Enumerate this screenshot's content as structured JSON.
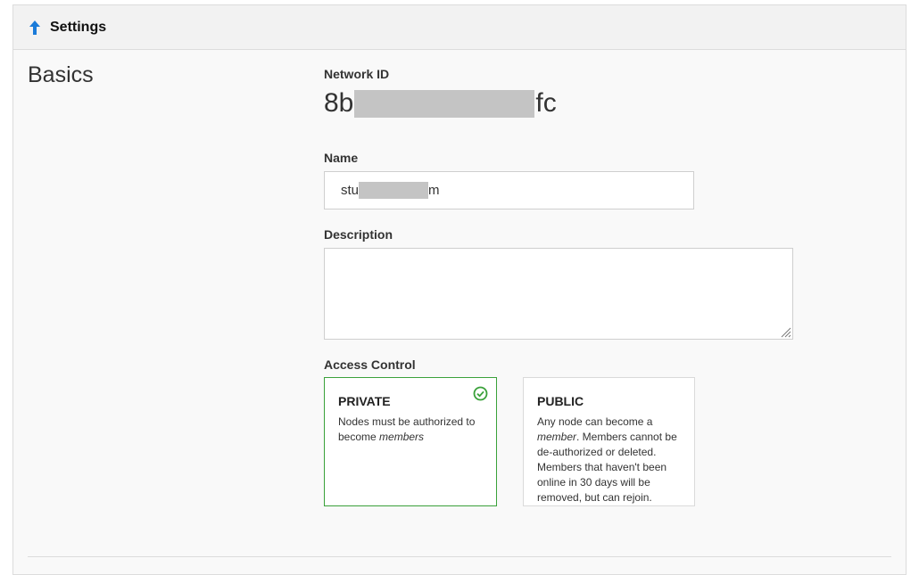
{
  "header": {
    "title": "Settings",
    "icon": "arrow-up-icon",
    "icon_color": "#1a7bd9"
  },
  "section": {
    "title": "Basics"
  },
  "network_id": {
    "label": "Network ID",
    "prefix": "8b",
    "suffix": "fc"
  },
  "name": {
    "label": "Name",
    "value_prefix": "stu",
    "value_suffix": "m"
  },
  "description": {
    "label": "Description",
    "value": ""
  },
  "access_control": {
    "label": "Access Control",
    "private": {
      "title": "PRIVATE",
      "desc_text": "Nodes must be authorized to become ",
      "desc_em": "members",
      "selected": true,
      "icon": "check-circle-icon",
      "accent": "#3aa13a"
    },
    "public": {
      "title": "PUBLIC",
      "desc_pre": "Any node can become a ",
      "desc_em": "member",
      "desc_post": ". Members cannot be de-authorized or deleted. Members that haven't been online in 30 days will be removed, but can rejoin.",
      "selected": false
    }
  }
}
